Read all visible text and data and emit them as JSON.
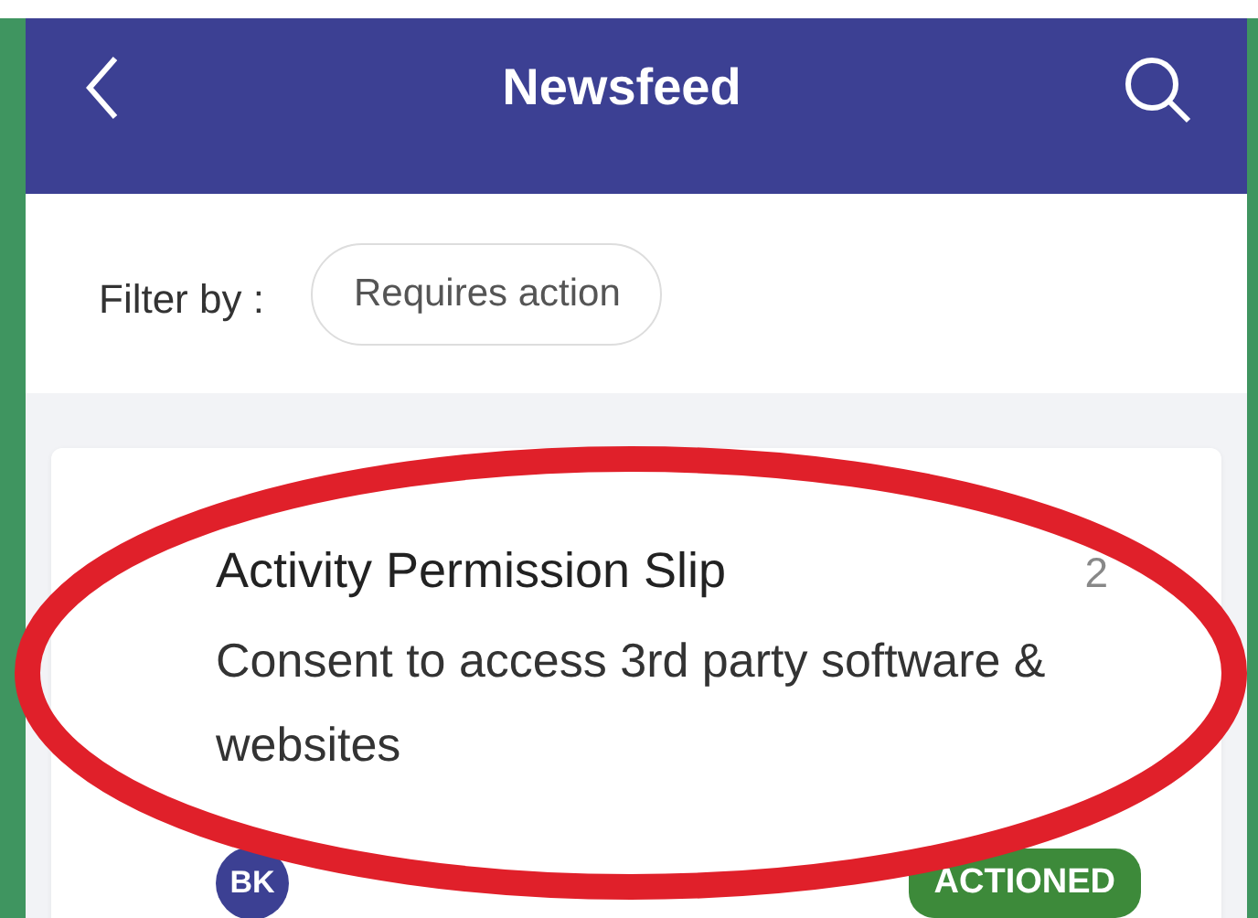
{
  "header": {
    "title": "Newsfeed"
  },
  "filter": {
    "label": "Filter by :",
    "chips": [
      {
        "label": "Requires action",
        "selected": false
      }
    ]
  },
  "feed": [
    {
      "title": "Activity Permission Slip",
      "time": "2",
      "description": "Consent to access 3rd party software & websites",
      "author_initials": "BK",
      "status": {
        "label": "ACTIONED",
        "kind": "actioned"
      }
    }
  ]
}
